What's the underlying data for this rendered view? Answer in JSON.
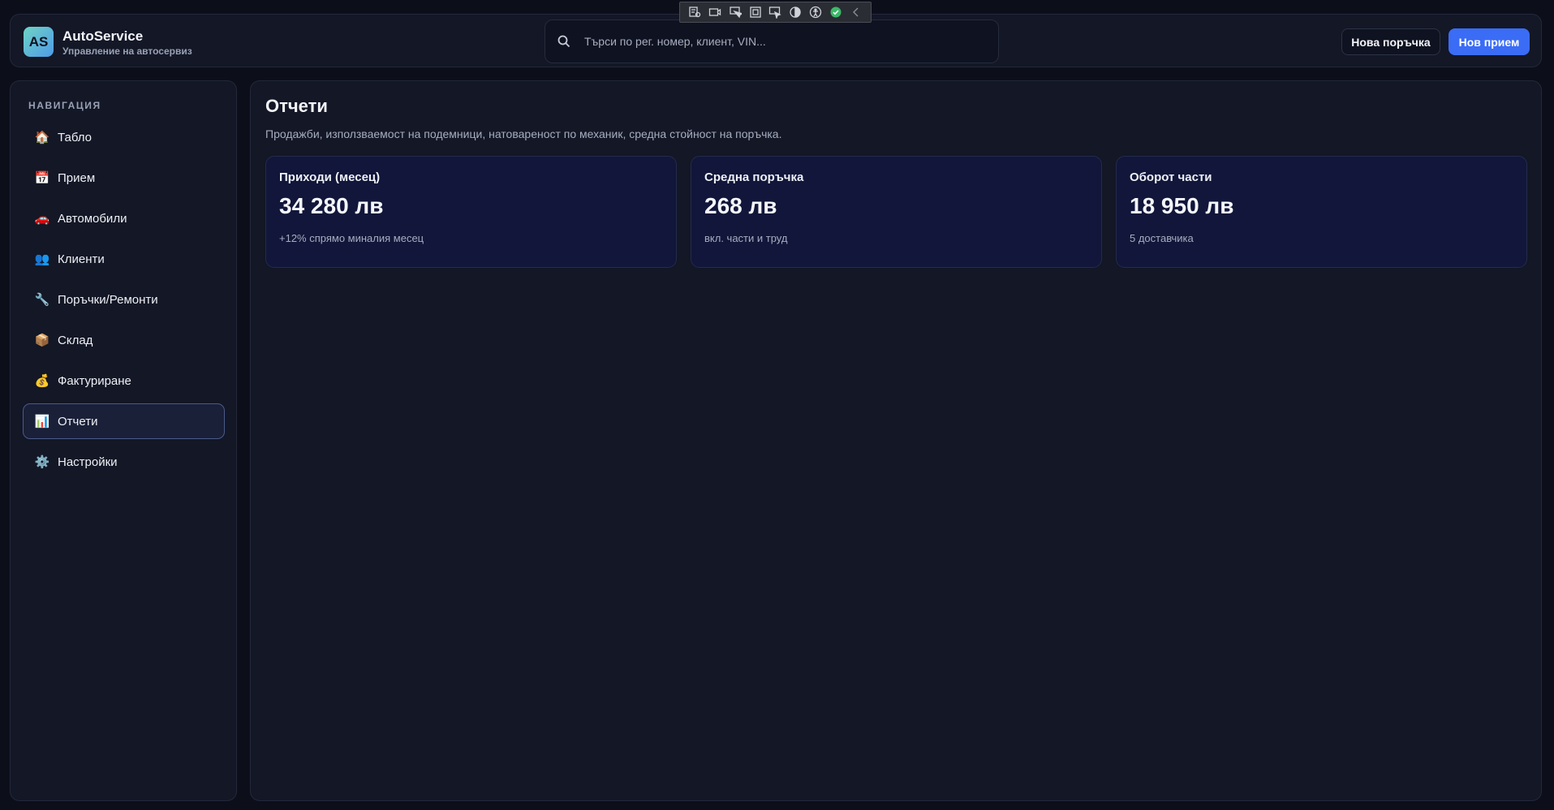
{
  "app": {
    "title": "AutoService",
    "subtitle": "Управление на автосервиз",
    "logo_text": "AS"
  },
  "search": {
    "placeholder": "Търси по рег. номер, клиент, VIN..."
  },
  "header_actions": {
    "new_order": "Нова поръчка",
    "new_intake": "Нов прием"
  },
  "sidebar": {
    "title": "НАВИГАЦИЯ",
    "items": [
      {
        "label": "Табло",
        "icon": "house-icon",
        "glyph": "🏠"
      },
      {
        "label": "Прием",
        "icon": "calendar-icon",
        "glyph": "📅"
      },
      {
        "label": "Автомобили",
        "icon": "car-icon",
        "glyph": "🚗"
      },
      {
        "label": "Клиенти",
        "icon": "users-icon",
        "glyph": "👥"
      },
      {
        "label": "Поръчки/Ремонти",
        "icon": "wrench-icon",
        "glyph": "🔧"
      },
      {
        "label": "Склад",
        "icon": "package-icon",
        "glyph": "📦"
      },
      {
        "label": "Фактуриране",
        "icon": "money-bag-icon",
        "glyph": "💰"
      },
      {
        "label": "Отчети",
        "icon": "bar-chart-icon",
        "glyph": "📊",
        "active": true
      },
      {
        "label": "Настройки",
        "icon": "gear-icon",
        "glyph": "⚙️"
      }
    ]
  },
  "main": {
    "title": "Отчети",
    "subtitle": "Продажби, използваемост на подемници, натовареност по механик, средна стойност на поръчка.",
    "cards": [
      {
        "title": "Приходи (месец)",
        "value": "34 280 лв",
        "note": "+12% спрямо миналия месец"
      },
      {
        "title": "Средна поръчка",
        "value": "268 лв",
        "note": "вкл. части и труд"
      },
      {
        "title": "Оборот части",
        "value": "18 950 лв",
        "note": "5 доставчика"
      }
    ]
  },
  "colors": {
    "background": "#0c0f1a",
    "panel": "#131726",
    "card": "#11163a",
    "accent": "#3b6cf6"
  }
}
